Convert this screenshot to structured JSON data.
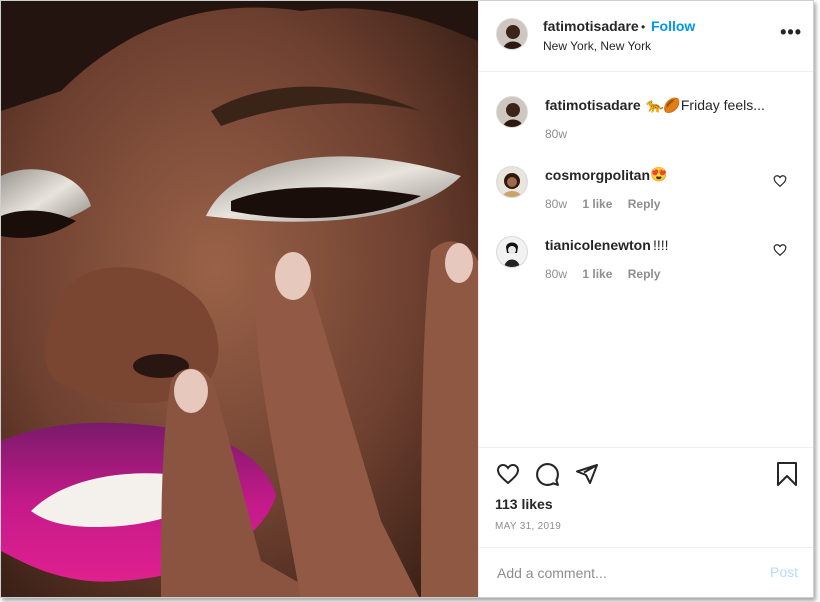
{
  "post": {
    "username": "fatimotisadare",
    "dot": "•",
    "follow_label": "Follow",
    "location": "New York, New York",
    "more_label": "•••"
  },
  "caption": {
    "username": "fatimotisadare",
    "text": "🐆🏉Friday feels...",
    "age": "80w"
  },
  "comments": [
    {
      "username": "cosmorgpolitan",
      "text": "😍",
      "age": "80w",
      "likes": "1 like",
      "reply": "Reply"
    },
    {
      "username": "tianicolenewton",
      "text": "!!!!",
      "age": "80w",
      "likes": "1 like",
      "reply": "Reply"
    }
  ],
  "engagement": {
    "likes": "113 likes",
    "date": "MAY 31, 2019"
  },
  "add_comment": {
    "placeholder": "Add a comment...",
    "post_label": "Post"
  },
  "colors": {
    "link": "#0095f6",
    "muted": "#8e8e8e",
    "post_disabled": "#b3dbff"
  },
  "icons": [
    "heart-icon",
    "comment-icon",
    "share-icon",
    "bookmark-icon",
    "more-icon"
  ]
}
